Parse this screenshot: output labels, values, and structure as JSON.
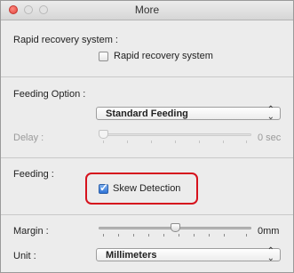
{
  "window": {
    "title": "More"
  },
  "rapid_recovery": {
    "section_label": "Rapid recovery system :",
    "checkbox_label": "Rapid recovery system",
    "checked": false
  },
  "feeding_option": {
    "section_label": "Feeding Option :",
    "select_value": "Standard Feeding",
    "delay_label": "Delay :",
    "delay_value": "0 sec",
    "delay_level": 0,
    "delay_enabled": false
  },
  "feeding": {
    "section_label": "Feeding :",
    "checkbox_label": "Skew Detection",
    "checked": true
  },
  "margin": {
    "label": "Margin :",
    "value": "0mm",
    "level": 0.5
  },
  "unit": {
    "label": "Unit :",
    "select_value": "Millimeters"
  },
  "colors": {
    "highlight": "#d6121d",
    "checkbox_checked": "#2f73d6"
  }
}
